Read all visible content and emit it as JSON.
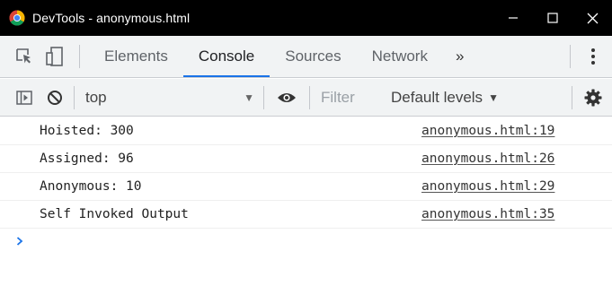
{
  "window": {
    "title": "DevTools - anonymous.html"
  },
  "tabs": [
    {
      "label": "Elements",
      "active": false
    },
    {
      "label": "Console",
      "active": true
    },
    {
      "label": "Sources",
      "active": false
    },
    {
      "label": "Network",
      "active": false
    }
  ],
  "tabs_overflow": "»",
  "toolbar": {
    "context": "top",
    "filter_placeholder": "Filter",
    "levels_label": "Default levels"
  },
  "console_messages": [
    {
      "text": "Hoisted: 300",
      "source": "anonymous.html:19"
    },
    {
      "text": "Assigned: 96",
      "source": "anonymous.html:26"
    },
    {
      "text": "Anonymous: 10",
      "source": "anonymous.html:29"
    },
    {
      "text": "Self Invoked Output",
      "source": "anonymous.html:35"
    }
  ],
  "colors": {
    "titlebar_bg": "#000000",
    "toolbar_bg": "#f1f3f4",
    "active_tab_underline": "#1a73e8",
    "prompt_arrow": "#1a73e8"
  },
  "icons": [
    "chrome-icon",
    "minimize-icon",
    "maximize-icon",
    "close-icon",
    "inspect-element-icon",
    "device-toolbar-icon",
    "kebab-menu-icon",
    "sidebar-toggle-icon",
    "clear-console-icon",
    "eye-icon",
    "gear-icon",
    "prompt-chevron-icon"
  ]
}
